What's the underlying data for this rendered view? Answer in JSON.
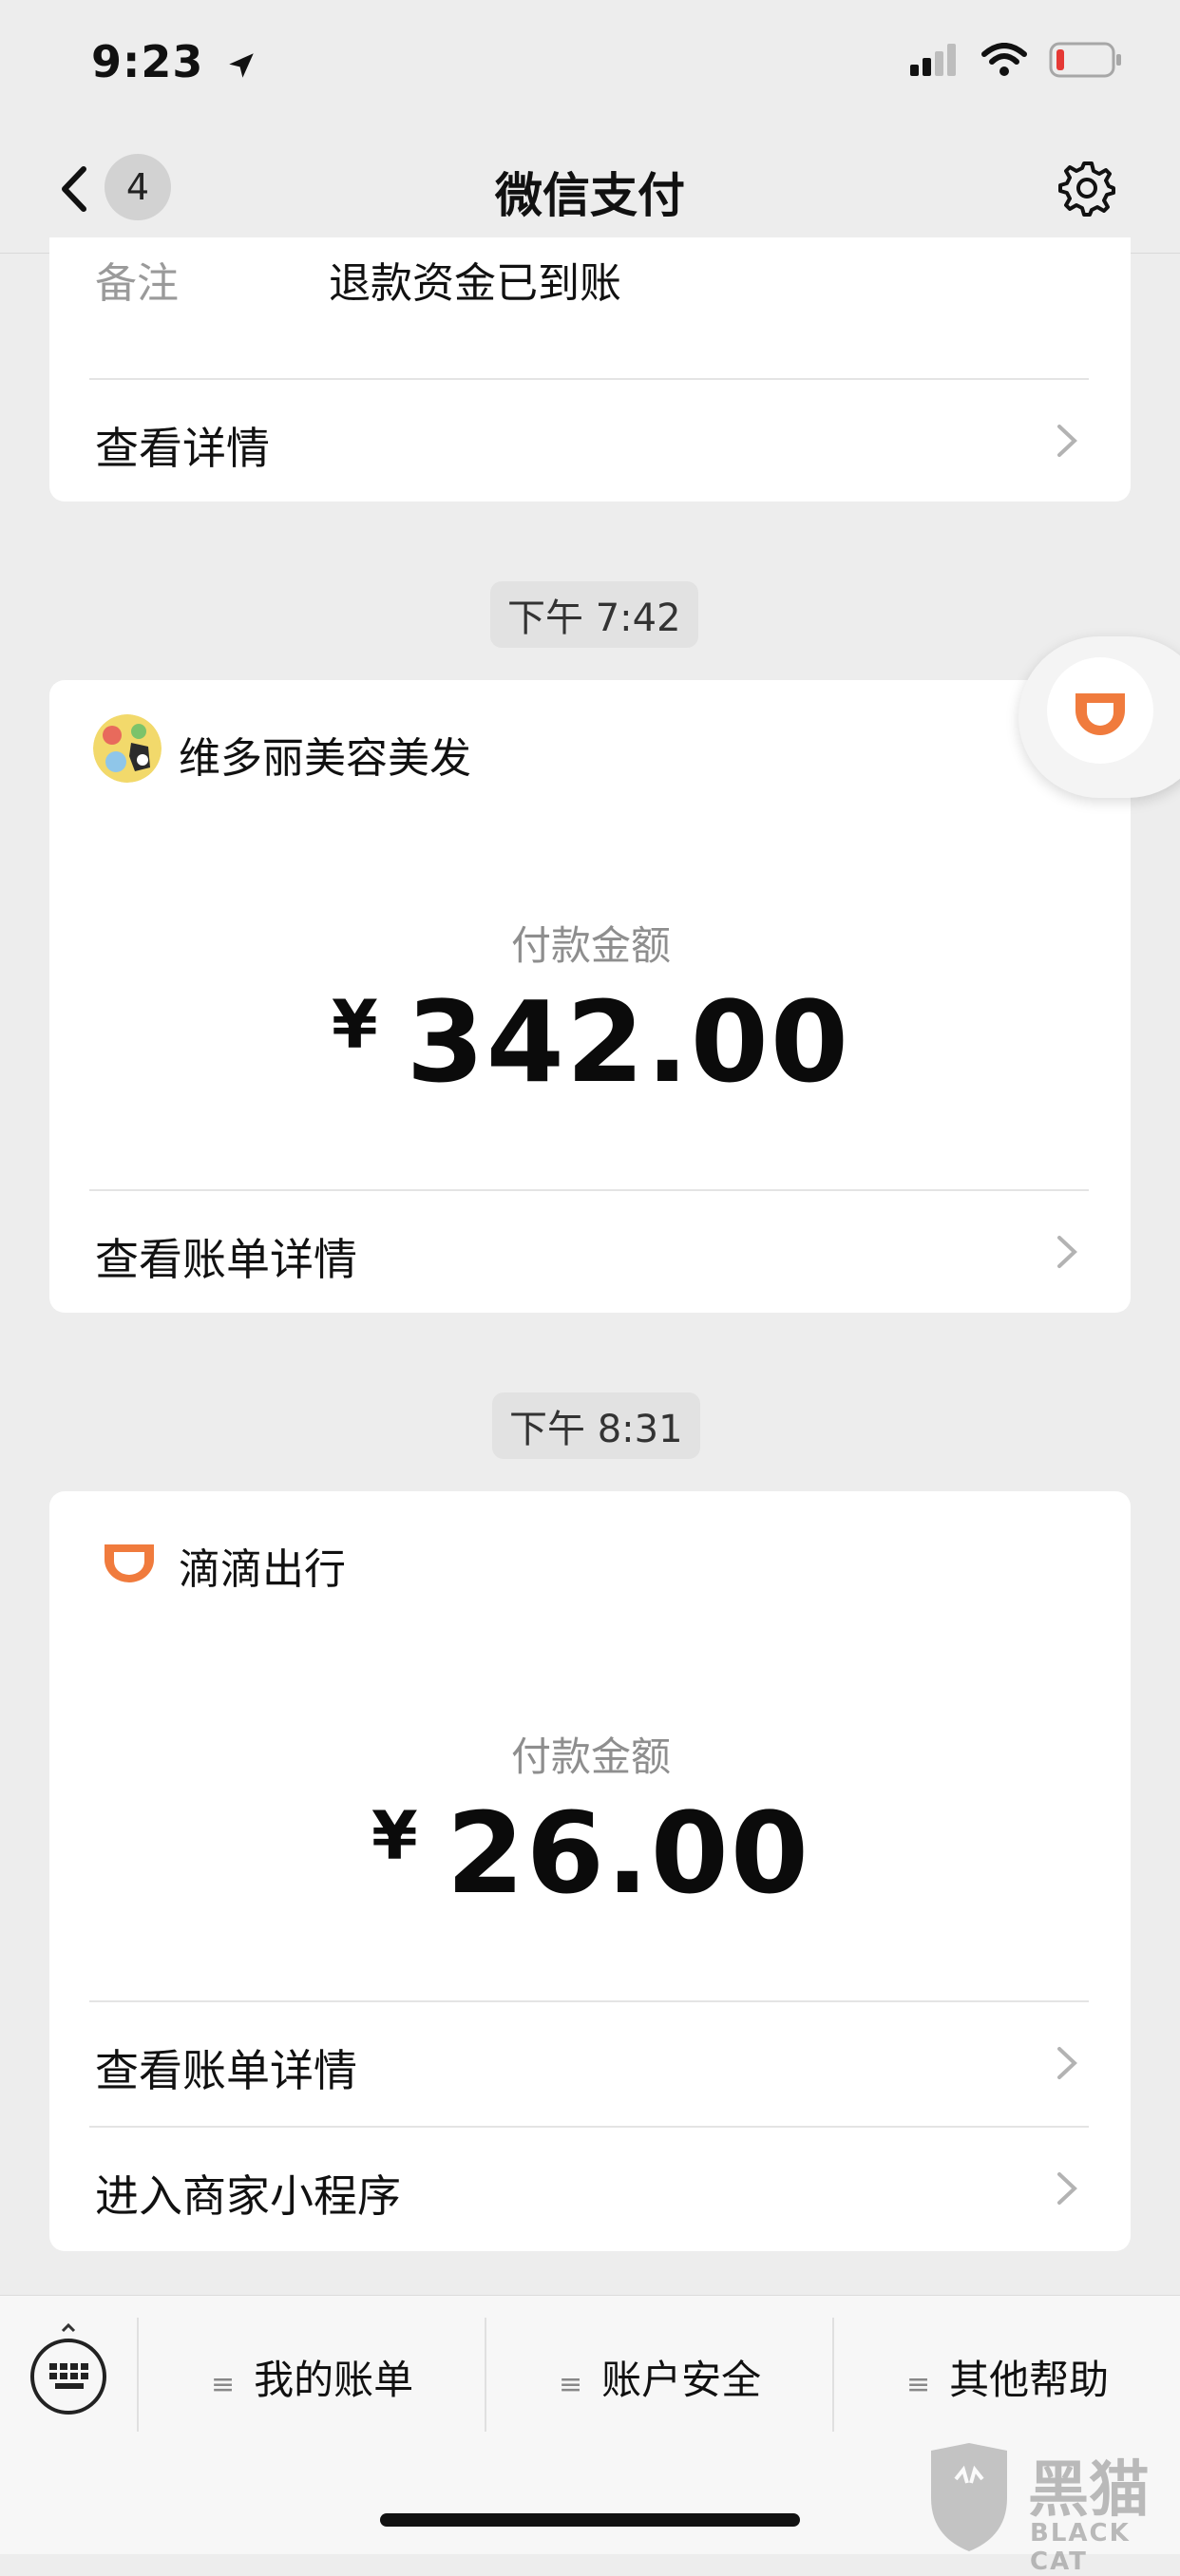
{
  "status": {
    "time": "9:23"
  },
  "nav": {
    "back_count": "4",
    "title": "微信支付"
  },
  "card_top": {
    "remark_label": "备注",
    "remark_value": "退款资金已到账",
    "detail_link": "查看详情"
  },
  "timestamps": [
    "下午 7:42",
    "下午 8:31"
  ],
  "card_salon": {
    "merchant": "维多丽美容美发",
    "amount_label": "付款金额",
    "currency": "¥",
    "amount": "342.00",
    "bill_link": "查看账单详情"
  },
  "card_didi": {
    "merchant": "滴滴出行",
    "amount_label": "付款金额",
    "currency": "¥",
    "amount": "26.00",
    "bill_link": "查看账单详情",
    "miniprogram_link": "进入商家小程序"
  },
  "bottom_bar": {
    "tabs": [
      "我的账单",
      "账户安全",
      "其他帮助"
    ]
  },
  "watermark": {
    "text_cn": "黑猫",
    "text_en": "BLACK CAT"
  },
  "colors": {
    "didi_orange": "#f07b3d",
    "background": "#ededed",
    "card": "#ffffff"
  }
}
